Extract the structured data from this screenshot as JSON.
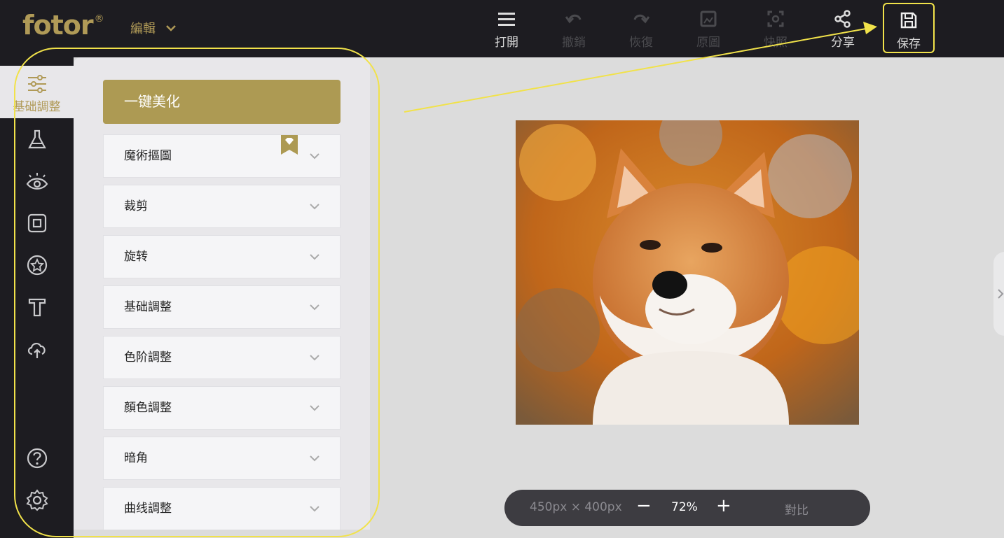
{
  "app": {
    "logo": "fotor",
    "logo_mark": "®",
    "mode_label": "編輯"
  },
  "toolbar": {
    "open": "打開",
    "undo": "撤銷",
    "redo": "恢復",
    "original": "原圖",
    "snapshot": "快照",
    "share": "分享",
    "save": "保存"
  },
  "leftnav": {
    "active_label": "基础調整"
  },
  "panel": {
    "one_click": "一键美化",
    "items": [
      "魔術摳圖",
      "裁剪",
      "旋转",
      "基础調整",
      "色阶調整",
      "顏色調整",
      "暗角",
      "曲线調整"
    ]
  },
  "canvas": {
    "image_desc_icon": "shiba-photo"
  },
  "zoombar": {
    "size": "450px × 400px",
    "minus": "−",
    "zoom": "72%",
    "plus": "+",
    "compare": "對比"
  },
  "colors": {
    "accent": "#ad9a53",
    "topbar": "#1d1c21",
    "highlight": "#f1e24a"
  }
}
